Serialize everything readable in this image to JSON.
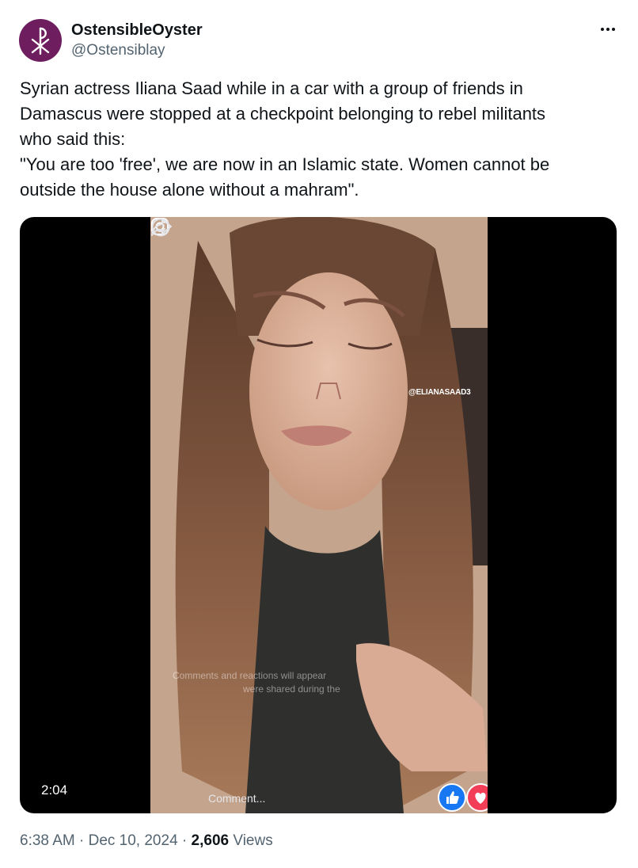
{
  "author": {
    "display_name": "OstensibleOyster",
    "handle": "@Ostensiblay",
    "avatar_icon": "chi-rho-icon",
    "avatar_color": "#6e1d5e"
  },
  "more_icon": "more-horizontal-icon",
  "tweet": {
    "lines": [
      "Syrian actress Iliana Saad while in a car with a group of friends in",
      "Damascus were stopped at a checkpoint belonging to rebel militants",
      "who said this:",
      "\"You are too 'free', we are now in an Islamic state. Women cannot be",
      "outside the house alone without a mahram\"."
    ]
  },
  "video": {
    "duration": "2:04",
    "instagram_tag": "@ELIANASAAD3",
    "overlay_line1": "Comments and reactions will appear",
    "overlay_line2": "were shared during the",
    "comment_placeholder": "Comment...",
    "icons": {
      "share": "share-icon",
      "emoji": "emoji-icon",
      "like": "like-icon",
      "love": "love-icon",
      "instagram": "instagram-icon"
    }
  },
  "meta": {
    "time": "6:38 AM",
    "separator": "·",
    "date": "Dec 10, 2024",
    "views_count": "2,606",
    "views_label": "Views"
  },
  "colors": {
    "text_primary": "#0f1419",
    "text_secondary": "#536471",
    "like_blue": "#1877f2",
    "love_red": "#f33e58"
  }
}
